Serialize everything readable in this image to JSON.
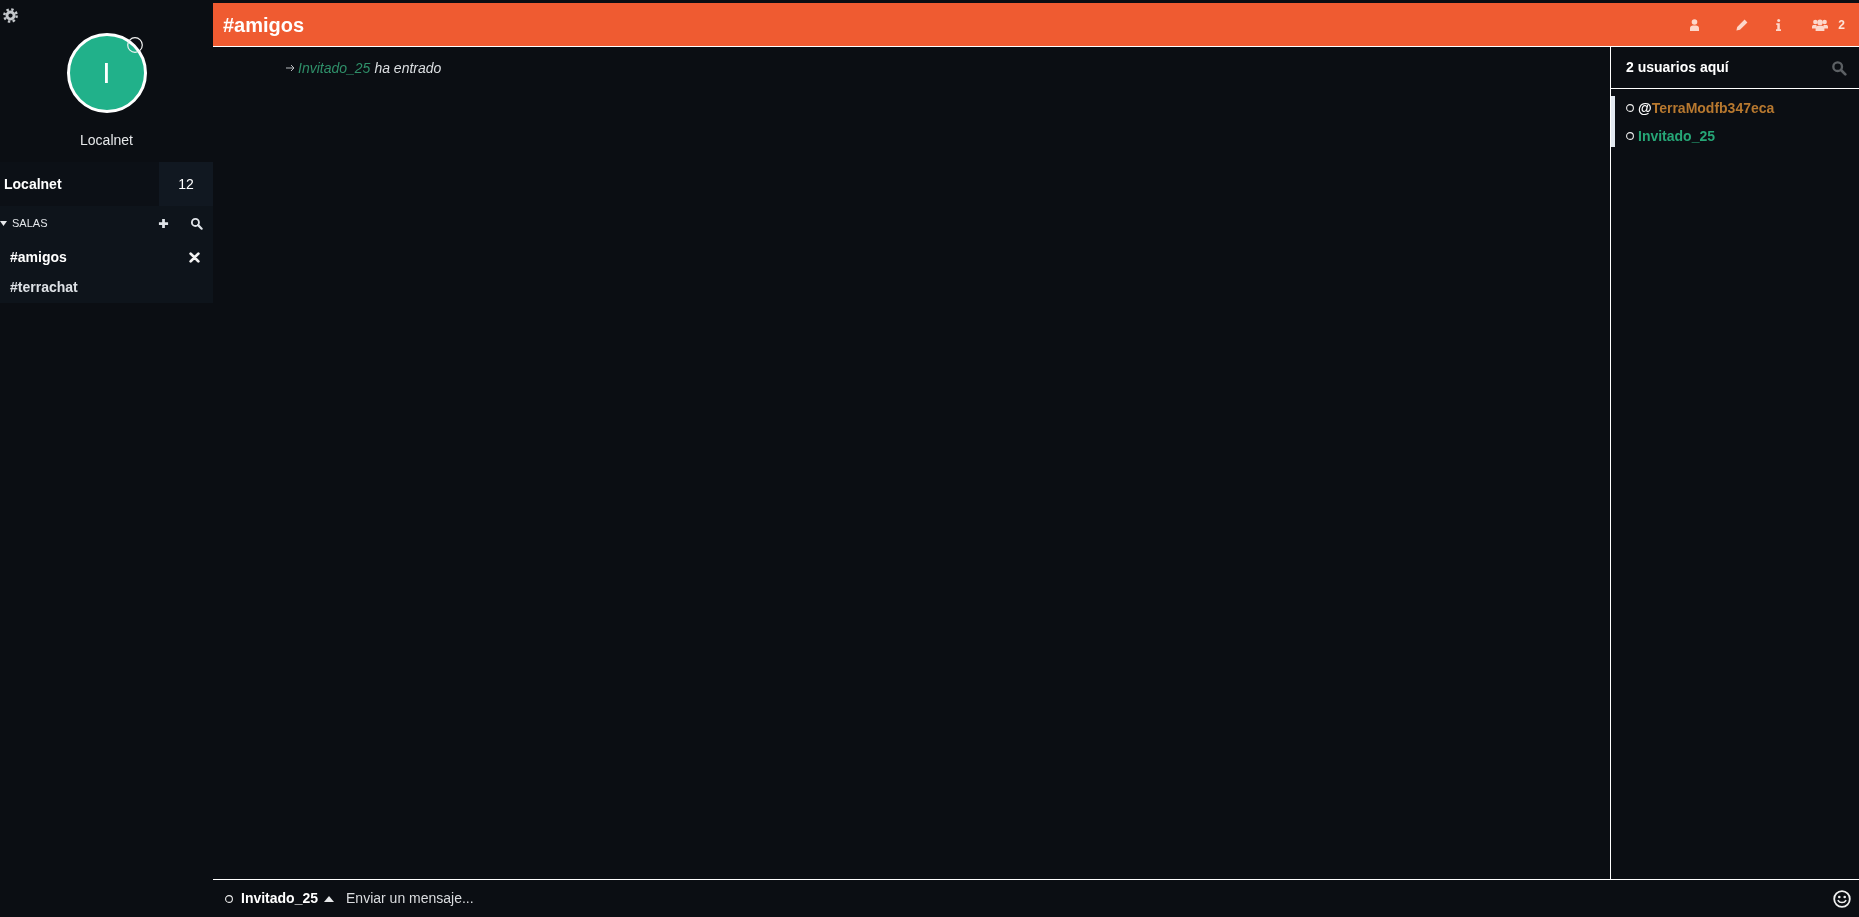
{
  "sidebar": {
    "profile": {
      "avatar_letter": "I",
      "name": "Localnet"
    },
    "network": {
      "name": "Localnet",
      "count": "12"
    },
    "rooms_section": {
      "title": "SALAS",
      "expanded": true,
      "rooms": [
        {
          "name": "#amigos",
          "selected": true
        },
        {
          "name": "#terrachat",
          "selected": false
        }
      ]
    }
  },
  "header": {
    "title": "#amigos",
    "user_count": "2"
  },
  "messages": [
    {
      "kind": "join",
      "nick": "Invitado_25",
      "color": "#2f8f69",
      "text": "ha entrado"
    }
  ],
  "users_panel": {
    "title": "2 usuarios aquí",
    "users": [
      {
        "prefix": "@",
        "name": "TerraModfb347eca",
        "color": "#b7782f"
      },
      {
        "name": "Invitado_25",
        "color": "#26a676"
      }
    ]
  },
  "composer": {
    "nick": "Invitado_25",
    "placeholder": "Enviar un mensaje..."
  }
}
